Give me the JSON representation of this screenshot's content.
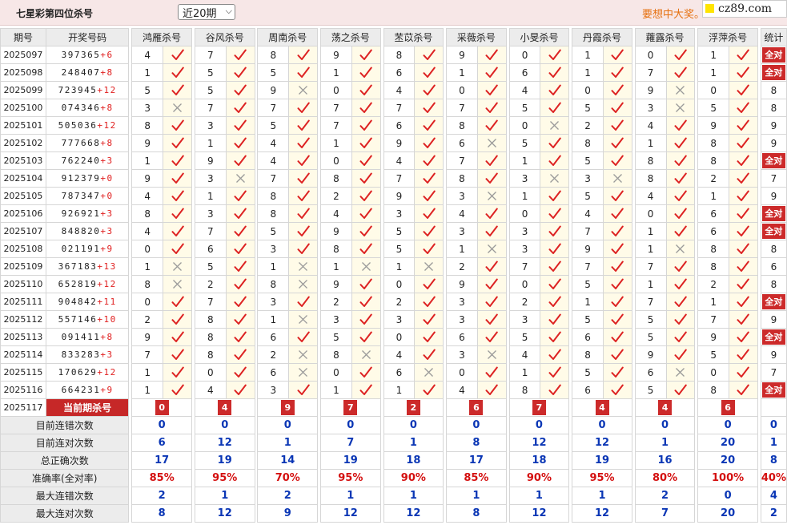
{
  "header": {
    "title": "七星彩第四位杀号",
    "select_value": "近20期",
    "promo": "要想中大奖。",
    "logo": "cz89.com"
  },
  "columns": {
    "issue": "期号",
    "draw": "开奖号码",
    "stat": "统计"
  },
  "experts": [
    "鸿雁杀号",
    "谷风杀号",
    "周南杀号",
    "荡之杀号",
    "苤苡杀号",
    "采薇杀号",
    "小旻杀号",
    "丹霞杀号",
    "蕹露杀号",
    "浮萍杀号"
  ],
  "full_label": "全对",
  "rows": [
    {
      "issue": "2025097",
      "digits": "397365",
      "sum": "+6",
      "kills": [
        [
          4,
          1
        ],
        [
          7,
          1
        ],
        [
          8,
          1
        ],
        [
          9,
          1
        ],
        [
          8,
          1
        ],
        [
          9,
          1
        ],
        [
          0,
          1
        ],
        [
          1,
          1
        ],
        [
          0,
          1
        ],
        [
          1,
          1
        ]
      ],
      "stat": "全对"
    },
    {
      "issue": "2025098",
      "digits": "248407",
      "sum": "+8",
      "kills": [
        [
          1,
          1
        ],
        [
          5,
          1
        ],
        [
          5,
          1
        ],
        [
          1,
          1
        ],
        [
          6,
          1
        ],
        [
          1,
          1
        ],
        [
          6,
          1
        ],
        [
          1,
          1
        ],
        [
          7,
          1
        ],
        [
          1,
          1
        ]
      ],
      "stat": "全对"
    },
    {
      "issue": "2025099",
      "digits": "723945",
      "sum": "+12",
      "kills": [
        [
          5,
          1
        ],
        [
          5,
          1
        ],
        [
          9,
          0
        ],
        [
          0,
          1
        ],
        [
          4,
          1
        ],
        [
          0,
          1
        ],
        [
          4,
          1
        ],
        [
          0,
          1
        ],
        [
          9,
          0
        ],
        [
          0,
          1
        ]
      ],
      "stat": "8"
    },
    {
      "issue": "2025100",
      "digits": "074346",
      "sum": "+8",
      "kills": [
        [
          3,
          0
        ],
        [
          7,
          1
        ],
        [
          7,
          1
        ],
        [
          7,
          1
        ],
        [
          7,
          1
        ],
        [
          7,
          1
        ],
        [
          5,
          1
        ],
        [
          5,
          1
        ],
        [
          3,
          0
        ],
        [
          5,
          1
        ]
      ],
      "stat": "8"
    },
    {
      "issue": "2025101",
      "digits": "505036",
      "sum": "+12",
      "kills": [
        [
          8,
          1
        ],
        [
          3,
          1
        ],
        [
          5,
          1
        ],
        [
          7,
          1
        ],
        [
          6,
          1
        ],
        [
          8,
          1
        ],
        [
          0,
          0
        ],
        [
          2,
          1
        ],
        [
          4,
          1
        ],
        [
          9,
          1
        ]
      ],
      "stat": "9"
    },
    {
      "issue": "2025102",
      "digits": "777668",
      "sum": "+8",
      "kills": [
        [
          9,
          1
        ],
        [
          1,
          1
        ],
        [
          4,
          1
        ],
        [
          1,
          1
        ],
        [
          9,
          1
        ],
        [
          6,
          0
        ],
        [
          5,
          1
        ],
        [
          8,
          1
        ],
        [
          1,
          1
        ],
        [
          8,
          1
        ]
      ],
      "stat": "9"
    },
    {
      "issue": "2025103",
      "digits": "762240",
      "sum": "+3",
      "kills": [
        [
          1,
          1
        ],
        [
          9,
          1
        ],
        [
          4,
          1
        ],
        [
          0,
          1
        ],
        [
          4,
          1
        ],
        [
          7,
          1
        ],
        [
          1,
          1
        ],
        [
          5,
          1
        ],
        [
          8,
          1
        ],
        [
          8,
          1
        ]
      ],
      "stat": "全对"
    },
    {
      "issue": "2025104",
      "digits": "912379",
      "sum": "+0",
      "kills": [
        [
          9,
          1
        ],
        [
          3,
          0
        ],
        [
          7,
          1
        ],
        [
          8,
          1
        ],
        [
          7,
          1
        ],
        [
          8,
          1
        ],
        [
          3,
          0
        ],
        [
          3,
          0
        ],
        [
          8,
          1
        ],
        [
          2,
          1
        ]
      ],
      "stat": "7"
    },
    {
      "issue": "2025105",
      "digits": "787347",
      "sum": "+0",
      "kills": [
        [
          4,
          1
        ],
        [
          1,
          1
        ],
        [
          8,
          1
        ],
        [
          2,
          1
        ],
        [
          9,
          1
        ],
        [
          3,
          0
        ],
        [
          1,
          1
        ],
        [
          5,
          1
        ],
        [
          4,
          1
        ],
        [
          1,
          1
        ]
      ],
      "stat": "9"
    },
    {
      "issue": "2025106",
      "digits": "926921",
      "sum": "+3",
      "kills": [
        [
          8,
          1
        ],
        [
          3,
          1
        ],
        [
          8,
          1
        ],
        [
          4,
          1
        ],
        [
          3,
          1
        ],
        [
          4,
          1
        ],
        [
          0,
          1
        ],
        [
          4,
          1
        ],
        [
          0,
          1
        ],
        [
          6,
          1
        ]
      ],
      "stat": "全对"
    },
    {
      "issue": "2025107",
      "digits": "848820",
      "sum": "+3",
      "kills": [
        [
          4,
          1
        ],
        [
          7,
          1
        ],
        [
          5,
          1
        ],
        [
          9,
          1
        ],
        [
          5,
          1
        ],
        [
          3,
          1
        ],
        [
          3,
          1
        ],
        [
          7,
          1
        ],
        [
          1,
          1
        ],
        [
          6,
          1
        ]
      ],
      "stat": "全对"
    },
    {
      "issue": "2025108",
      "digits": "021191",
      "sum": "+9",
      "kills": [
        [
          0,
          1
        ],
        [
          6,
          1
        ],
        [
          3,
          1
        ],
        [
          8,
          1
        ],
        [
          5,
          1
        ],
        [
          1,
          0
        ],
        [
          3,
          1
        ],
        [
          9,
          1
        ],
        [
          1,
          0
        ],
        [
          8,
          1
        ]
      ],
      "stat": "8"
    },
    {
      "issue": "2025109",
      "digits": "367183",
      "sum": "+13",
      "kills": [
        [
          1,
          0
        ],
        [
          5,
          1
        ],
        [
          1,
          0
        ],
        [
          1,
          0
        ],
        [
          1,
          0
        ],
        [
          2,
          1
        ],
        [
          7,
          1
        ],
        [
          7,
          1
        ],
        [
          7,
          1
        ],
        [
          8,
          1
        ]
      ],
      "stat": "6"
    },
    {
      "issue": "2025110",
      "digits": "652819",
      "sum": "+12",
      "kills": [
        [
          8,
          0
        ],
        [
          2,
          1
        ],
        [
          8,
          0
        ],
        [
          9,
          1
        ],
        [
          0,
          1
        ],
        [
          9,
          1
        ],
        [
          0,
          1
        ],
        [
          5,
          1
        ],
        [
          1,
          1
        ],
        [
          2,
          1
        ]
      ],
      "stat": "8"
    },
    {
      "issue": "2025111",
      "digits": "904842",
      "sum": "+11",
      "kills": [
        [
          0,
          1
        ],
        [
          7,
          1
        ],
        [
          3,
          1
        ],
        [
          2,
          1
        ],
        [
          2,
          1
        ],
        [
          3,
          1
        ],
        [
          2,
          1
        ],
        [
          1,
          1
        ],
        [
          7,
          1
        ],
        [
          1,
          1
        ]
      ],
      "stat": "全对"
    },
    {
      "issue": "2025112",
      "digits": "557146",
      "sum": "+10",
      "kills": [
        [
          2,
          1
        ],
        [
          8,
          1
        ],
        [
          1,
          0
        ],
        [
          3,
          1
        ],
        [
          3,
          1
        ],
        [
          3,
          1
        ],
        [
          3,
          1
        ],
        [
          5,
          1
        ],
        [
          5,
          1
        ],
        [
          7,
          1
        ]
      ],
      "stat": "9"
    },
    {
      "issue": "2025113",
      "digits": "091411",
      "sum": "+8",
      "kills": [
        [
          9,
          1
        ],
        [
          8,
          1
        ],
        [
          6,
          1
        ],
        [
          5,
          1
        ],
        [
          0,
          1
        ],
        [
          6,
          1
        ],
        [
          5,
          1
        ],
        [
          6,
          1
        ],
        [
          5,
          1
        ],
        [
          9,
          1
        ]
      ],
      "stat": "全对"
    },
    {
      "issue": "2025114",
      "digits": "833283",
      "sum": "+3",
      "kills": [
        [
          7,
          1
        ],
        [
          8,
          1
        ],
        [
          2,
          0
        ],
        [
          8,
          0
        ],
        [
          4,
          1
        ],
        [
          3,
          0
        ],
        [
          4,
          1
        ],
        [
          8,
          1
        ],
        [
          9,
          1
        ],
        [
          5,
          1
        ]
      ],
      "stat": "9"
    },
    {
      "issue": "2025115",
      "digits": "170629",
      "sum": "+12",
      "kills": [
        [
          1,
          1
        ],
        [
          0,
          1
        ],
        [
          6,
          0
        ],
        [
          0,
          1
        ],
        [
          6,
          0
        ],
        [
          0,
          1
        ],
        [
          1,
          1
        ],
        [
          5,
          1
        ],
        [
          6,
          0
        ],
        [
          0,
          1
        ]
      ],
      "stat": "7"
    },
    {
      "issue": "2025116",
      "digits": "664231",
      "sum": "+9",
      "kills": [
        [
          1,
          1
        ],
        [
          4,
          1
        ],
        [
          3,
          1
        ],
        [
          1,
          1
        ],
        [
          1,
          1
        ],
        [
          4,
          1
        ],
        [
          8,
          1
        ],
        [
          6,
          1
        ],
        [
          5,
          1
        ],
        [
          8,
          1
        ]
      ],
      "stat": "全对"
    }
  ],
  "current": {
    "issue": "2025117",
    "label": "当前期杀号",
    "kills": [
      "0",
      "4",
      "9",
      "7",
      "2",
      "6",
      "7",
      "4",
      "4",
      "6"
    ]
  },
  "stats": [
    {
      "label": "目前连错次数",
      "values": [
        "0",
        "0",
        "0",
        "0",
        "0",
        "0",
        "0",
        "0",
        "0",
        "0"
      ],
      "stat": "0",
      "red": false
    },
    {
      "label": "目前连对次数",
      "values": [
        "6",
        "12",
        "1",
        "7",
        "1",
        "8",
        "12",
        "12",
        "1",
        "20"
      ],
      "stat": "1",
      "red": false
    },
    {
      "label": "总正确次数",
      "values": [
        "17",
        "19",
        "14",
        "19",
        "18",
        "17",
        "18",
        "19",
        "16",
        "20"
      ],
      "stat": "8",
      "red": false
    },
    {
      "label": "准确率(全对率)",
      "values": [
        "85%",
        "95%",
        "70%",
        "95%",
        "90%",
        "85%",
        "90%",
        "95%",
        "80%",
        "100%"
      ],
      "stat": "40%",
      "red": true
    },
    {
      "label": "最大连错次数",
      "values": [
        "2",
        "1",
        "2",
        "1",
        "1",
        "1",
        "1",
        "1",
        "2",
        "0"
      ],
      "stat": "4",
      "red": false
    },
    {
      "label": "最大连对次数",
      "values": [
        "8",
        "12",
        "9",
        "12",
        "12",
        "8",
        "12",
        "12",
        "7",
        "20"
      ],
      "stat": "2",
      "red": false
    }
  ],
  "colors": {
    "accent": "#cc2a2a",
    "check": "#dd2222",
    "cross": "#9a9a9a",
    "stat_blue": "#0a36b5",
    "stat_red": "#d41010",
    "promo": "#e6700f"
  }
}
